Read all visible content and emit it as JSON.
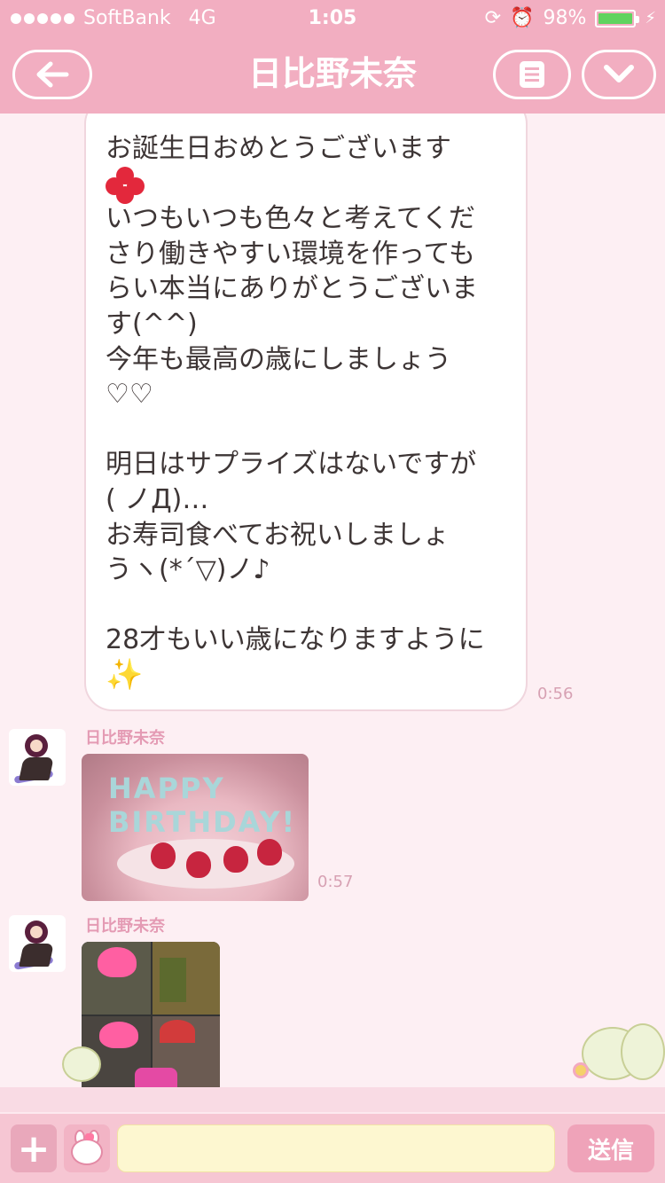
{
  "status_bar": {
    "carrier": "SoftBank",
    "network": "4G",
    "time": "1:05",
    "battery": "98%",
    "battery_level": 0.98
  },
  "nav": {
    "title": "日比野未奈",
    "back_icon": "back-arrow-icon",
    "menu_icon": "menu-icon",
    "down_icon": "chevron-down-icon"
  },
  "messages": [
    {
      "type": "text",
      "lines": [
        "お誕生日おめとうございます",
        "",
        "いつもいつも色々と考えてくだ",
        "さり働きやすい環境を作っても",
        "らい本当にありがとうございま",
        "す(^^)",
        "今年も最高の歳にしましょう",
        "♡♡",
        "",
        "明日はサプライズはないですが",
        "( ノД)…",
        "お寿司食べてお祝いしましょ",
        "うヽ(*´▽)ノ♪",
        "",
        "28才もいい歳になりますように",
        "✨"
      ],
      "time": "0:56"
    },
    {
      "type": "image",
      "sender": "日比野未奈",
      "image_text": "HAPPY BIRTHDAY!",
      "time": "0:57"
    },
    {
      "type": "image",
      "sender": "日比野未奈"
    }
  ],
  "input": {
    "plus_label": "+",
    "placeholder": "",
    "value": "",
    "send_label": "送信"
  },
  "colors": {
    "header": "#f2aec1",
    "background": "#fdeff3",
    "input_bg": "#fdf7d0",
    "send_button": "#efa3b9"
  }
}
